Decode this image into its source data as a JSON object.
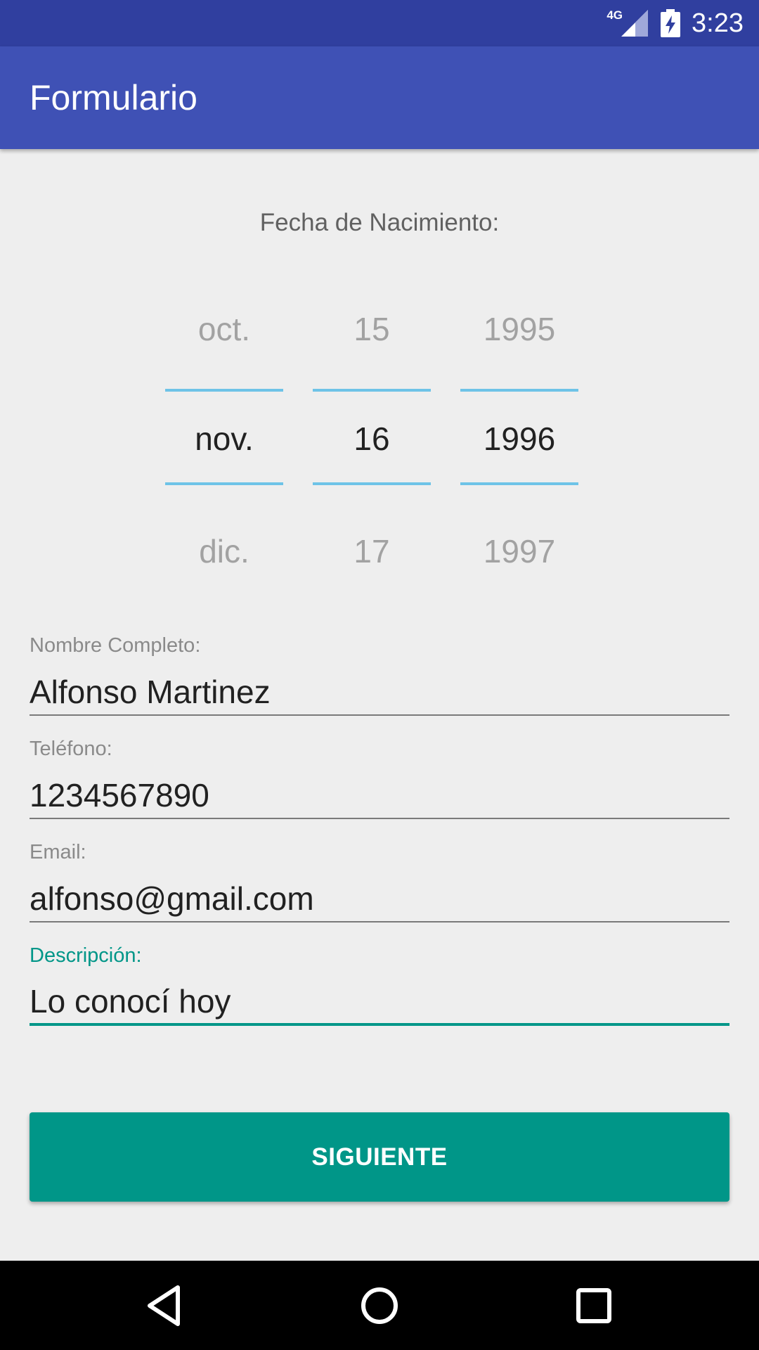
{
  "status_bar": {
    "network": "4G",
    "time": "3:23",
    "icons": [
      "signal-icon",
      "battery-charging-icon"
    ]
  },
  "app_bar": {
    "title": "Formulario"
  },
  "date_picker": {
    "label": "Fecha de Nacimiento:",
    "month": {
      "prev": "oct.",
      "selected": "nov.",
      "next": "dic."
    },
    "day": {
      "prev": "15",
      "selected": "16",
      "next": "17"
    },
    "year": {
      "prev": "1995",
      "selected": "1996",
      "next": "1997"
    }
  },
  "form": {
    "name": {
      "label": "Nombre Completo:",
      "value": "Alfonso Martinez"
    },
    "phone": {
      "label": "Teléfono:",
      "value": "1234567890"
    },
    "email": {
      "label": "Email:",
      "value": "alfonso@gmail.com"
    },
    "description": {
      "label": "Descripción:",
      "value": "Lo conocí hoy"
    }
  },
  "button": {
    "next_label": "SIGUIENTE"
  },
  "nav_bar": {
    "icons": [
      "back-icon",
      "home-icon",
      "recents-icon"
    ]
  },
  "colors": {
    "status_bar": "#303f9f",
    "app_bar": "#3f51b5",
    "accent": "#009688",
    "picker_divider": "#6ec3e7",
    "background": "#eeeeee"
  }
}
